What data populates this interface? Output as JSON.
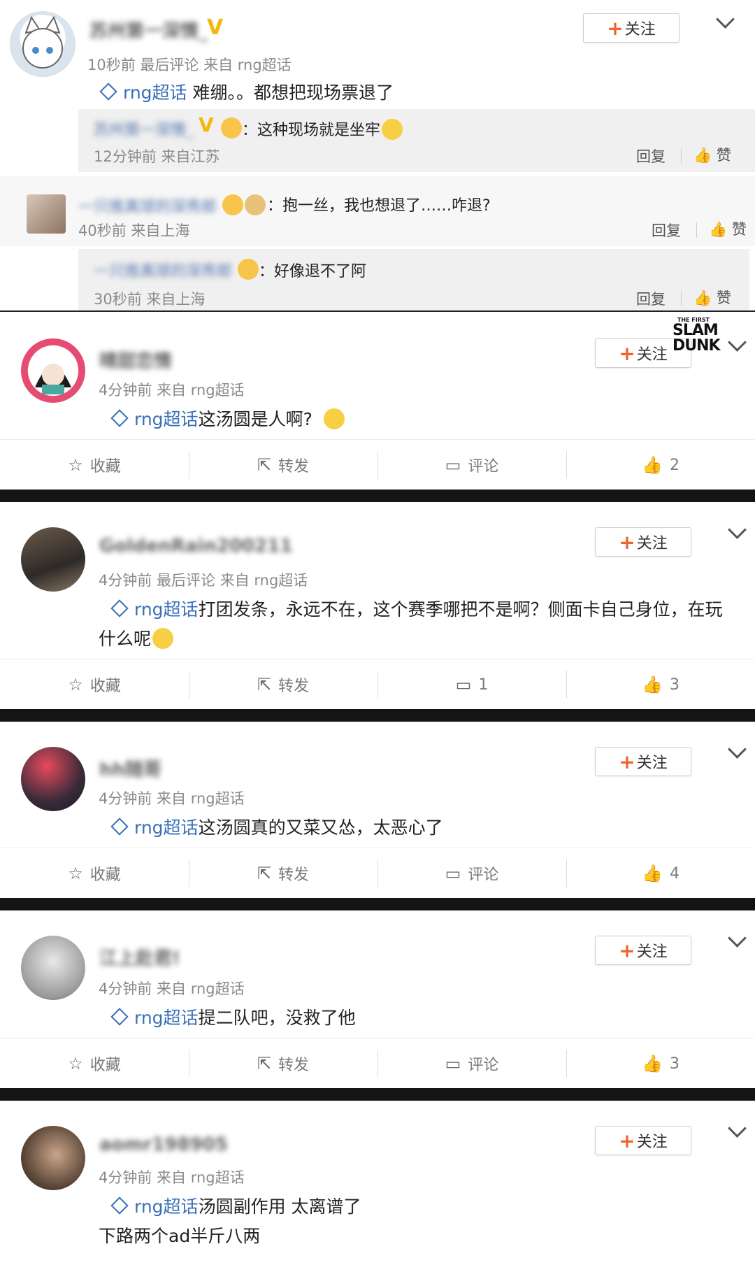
{
  "top": {
    "username": "苏州第一深情_",
    "meta": "10秒前 最后评论 来自 rng超话",
    "topic": "rng超话",
    "text": " 难绷。。都想把现场票退了",
    "follow_label": "关注",
    "replies": [
      {
        "user": "苏州第一深情_",
        "text": "：这种现场就是坐牢",
        "meta": "12分钟前 来自江苏",
        "reply": "回复",
        "like": "赞"
      },
      {
        "user": "一只推真球的深秀郎",
        "text": "：抱一丝，我也想退了……咋退?",
        "meta": "40秒前 来自上海",
        "reply": "回复",
        "like": "赞"
      },
      {
        "user": "一只推真球的深秀郎",
        "text": "：好像退不了阿",
        "meta": "30秒前 来自上海",
        "reply": "回复",
        "like": "赞"
      }
    ]
  },
  "slam_dunk": {
    "line1": "THE FIRST",
    "line2": "SLAM",
    "line3": "DUNK"
  },
  "posts": [
    {
      "username": "晴甜恋情",
      "meta": "4分钟前 来自 rng超话",
      "topic": "rng超话",
      "text": "这汤圆是人啊?",
      "text2": "",
      "follow": "关注",
      "fav": "收藏",
      "repost": "转发",
      "comment": "评论",
      "likes": "2"
    },
    {
      "username": "GoldenRain200211",
      "meta": "4分钟前 最后评论 来自 rng超话",
      "topic": "rng超话",
      "text": "打团发条，永远不在，这个赛季哪把不是啊？侧面卡自己身位，在玩",
      "text2": "什么呢",
      "follow": "关注",
      "fav": "收藏",
      "repost": "转发",
      "comment": "1",
      "likes": "3"
    },
    {
      "username": "hh随哥",
      "meta": "4分钟前 来自 rng超话",
      "topic": "rng超话",
      "text": "这汤圆真的又菜又怂，太恶心了",
      "text2": "",
      "follow": "关注",
      "fav": "收藏",
      "repost": "转发",
      "comment": "评论",
      "likes": "4"
    },
    {
      "username": "江上赴君!",
      "meta": "4分钟前 来自 rng超话",
      "topic": "rng超话",
      "text": "提二队吧，没救了他",
      "text2": "",
      "follow": "关注",
      "fav": "收藏",
      "repost": "转发",
      "comment": "评论",
      "likes": "3"
    },
    {
      "username": "aomr198905",
      "meta": "4分钟前 来自 rng超话",
      "topic": "rng超话",
      "text": "汤圆副作用 太离谱了",
      "text2": "下路两个ad半斤八两",
      "follow": "关注"
    }
  ],
  "colors": {
    "topic": "#3a6fb8",
    "follow_plus": "#f0622f",
    "v_badge": "#f5b70a",
    "separator": "#141414"
  }
}
